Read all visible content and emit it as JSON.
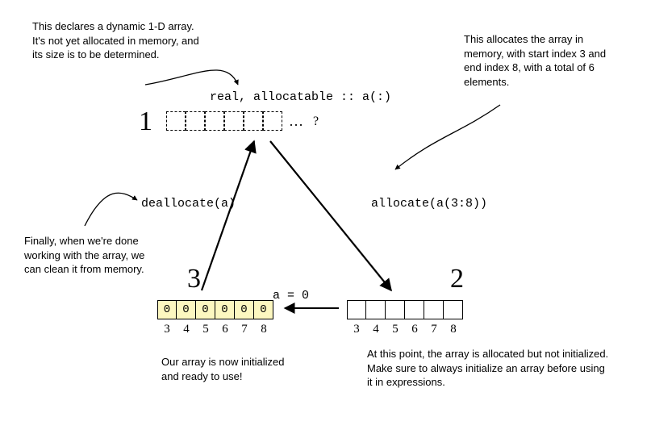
{
  "notes": {
    "declare": "This declares a dynamic 1-D array. It's not yet allocated in memory, and its size is to be determined.",
    "allocate": "This allocates the array in memory, with start index 3 and end index 8, with a total of 6 elements.",
    "deallocate": "Finally, when we're done working with the array, we can clean it from memory.",
    "uninitialized": "At this point, the array is allocated but not initialized. Make sure to always initialize an array before using it in expressions.",
    "initialized": "Our array is now initialized and ready to use!"
  },
  "code": {
    "declare": "real, allocatable :: a(:)",
    "allocate": "allocate(a(3:8))",
    "deallocate": "deallocate(a)",
    "assign": "a = 0"
  },
  "steps": {
    "one": "1",
    "two": "2",
    "three": "3"
  },
  "symbols": {
    "dots": "…",
    "question": "?"
  },
  "arrays": {
    "indices": [
      "3",
      "4",
      "5",
      "6",
      "7",
      "8"
    ],
    "zeros": [
      "0",
      "0",
      "0",
      "0",
      "0",
      "0"
    ]
  }
}
